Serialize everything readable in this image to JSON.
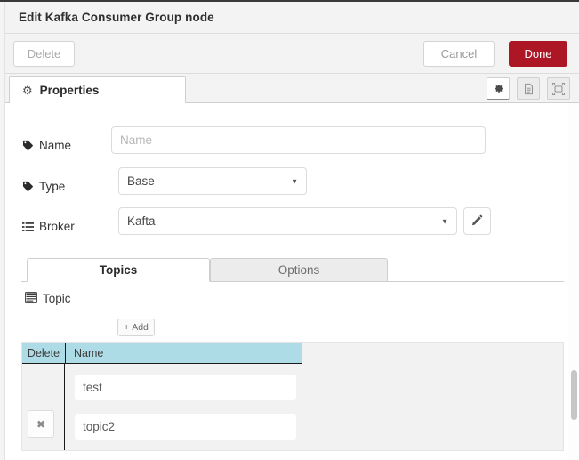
{
  "window": {
    "title": "Edit Kafka Consumer Group node"
  },
  "toolbar": {
    "delete_label": "Delete",
    "cancel_label": "Cancel",
    "done_label": "Done",
    "done_color": "#ad1625"
  },
  "tabstrip": {
    "properties_tab": {
      "label": "Properties",
      "icon": "gear-icon",
      "glyph": "⚙"
    },
    "icon_buttons": [
      {
        "name": "properties-gear-button",
        "icon": "gear-icon",
        "active": true
      },
      {
        "name": "description-button",
        "icon": "document-icon",
        "active": false
      },
      {
        "name": "appearance-button",
        "icon": "node-appearance-icon",
        "active": false
      }
    ]
  },
  "form": {
    "name": {
      "label": "Name",
      "icon": "tag-icon",
      "value": "",
      "placeholder": "Name"
    },
    "type": {
      "label": "Type",
      "icon": "tag-icon",
      "value": "Base",
      "options": [
        "Base"
      ]
    },
    "broker": {
      "label": "Broker",
      "icon": "list-icon",
      "value": "Kafta",
      "options": [
        "Kafta"
      ],
      "edit_button_icon": "pencil-icon"
    }
  },
  "inner_tabs": {
    "active": "Topics",
    "items": [
      {
        "label": "Topics",
        "active": true
      },
      {
        "label": "Options",
        "active": false
      }
    ]
  },
  "topics_section": {
    "label": "Topic",
    "icon": "table-icon",
    "add_button": {
      "label": "Add",
      "icon": "plus-icon",
      "glyph": "+"
    },
    "table": {
      "header_color": "#addbe6",
      "columns": [
        "Delete",
        "Name"
      ],
      "rows": [
        {
          "name": "test",
          "has_delete_button": false,
          "delete_glyph": ""
        },
        {
          "name": "topic2",
          "has_delete_button": true,
          "delete_glyph": "✖"
        }
      ]
    }
  }
}
